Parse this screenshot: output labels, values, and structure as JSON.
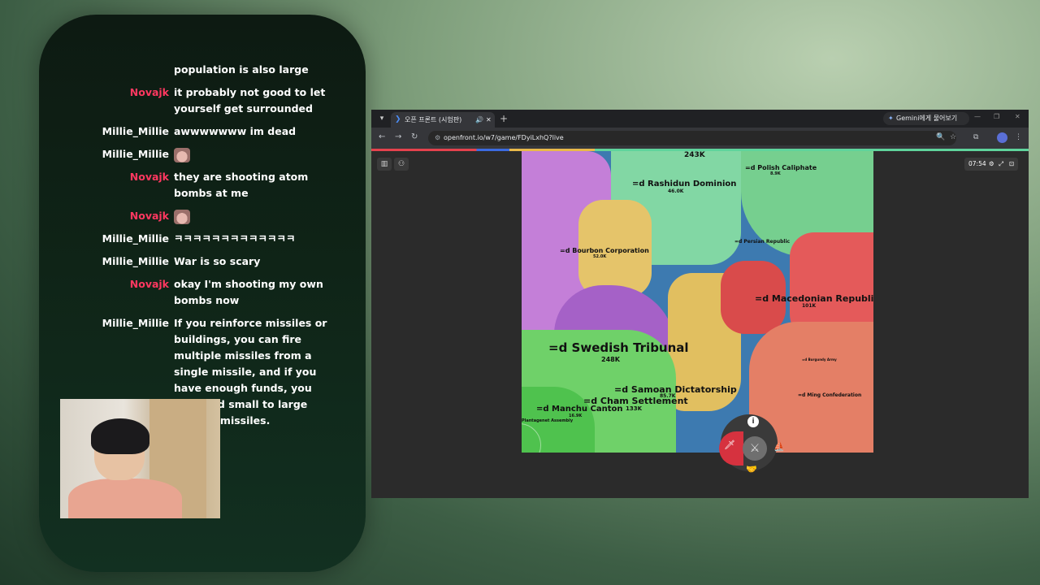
{
  "chat": {
    "messages": [
      {
        "user": "",
        "text": "population is also large",
        "user_style": "millie"
      },
      {
        "user": "Novajk",
        "text": "it probably not good to let yourself get surrounded",
        "user_style": "novajk"
      },
      {
        "user": "Millie_Millie",
        "text": "awwwwwww im dead",
        "user_style": "millie"
      },
      {
        "user": "Millie_Millie",
        "text": "",
        "emote": "cat-emote",
        "user_style": "millie"
      },
      {
        "user": "Novajk",
        "text": "they are shooting atom bombs at me",
        "user_style": "novajk"
      },
      {
        "user": "Novajk",
        "text": "",
        "emote": "cat-emote",
        "user_style": "novajk"
      },
      {
        "user": "Millie_Millie",
        "text": "ㅋㅋㅋㅋㅋㅋㅋㅋㅋㅋㅋㅋㅋ",
        "user_style": "millie"
      },
      {
        "user": "Millie_Millie",
        "text": "War is so scary",
        "user_style": "millie"
      },
      {
        "user": "Novajk",
        "text": "okay I'm shooting my own bombs now",
        "user_style": "novajk"
      },
      {
        "user": "Millie_Millie",
        "text": "If you reinforce missiles or buildings, you can fire multiple missiles from a single missile, and if you have enough funds, you can send small to large nuclear missiles.",
        "user_style": "millie"
      }
    ]
  },
  "browser": {
    "tab_title": "오픈 프론트 (시험판)",
    "new_tab": "+",
    "gemini_label": "Gemini에게 물어보기",
    "url": "openfront.io/w7/game/FDyiLxhQ?live"
  },
  "game": {
    "timer": "07:54",
    "nations": [
      {
        "name": "=d Rashidun Dominion",
        "pop": "46.0K"
      },
      {
        "name": "=d Polish Caliphate",
        "pop": "8.9K"
      },
      {
        "name": "=d Bourbon Corporation",
        "pop": "52.0K"
      },
      {
        "name": "=d Persian Republic",
        "pop": ""
      },
      {
        "name": "=d Macedonian Republic",
        "pop": "101K"
      },
      {
        "name": "=d Swedish Tribunal",
        "pop": "248K"
      },
      {
        "name": "=d Samoan Dictatorship",
        "pop": "85.7K"
      },
      {
        "name": "=d Cham Settlement",
        "pop": "133K"
      },
      {
        "name": "=d Manchu Canton",
        "pop": "16.9K"
      },
      {
        "name": "Plantagenet Assembly",
        "pop": ""
      },
      {
        "name": "=d Ming Confederation",
        "pop": ""
      },
      {
        "name": "=d Burgundy Army",
        "pop": ""
      }
    ],
    "top_pop": "243K",
    "colors": {
      "ocean": "#3d7ab0",
      "purple": "#c07fd6",
      "green": "#7fd494",
      "yellow": "#e3c56b",
      "red": "#d95353",
      "salmon": "#e58a67"
    }
  }
}
